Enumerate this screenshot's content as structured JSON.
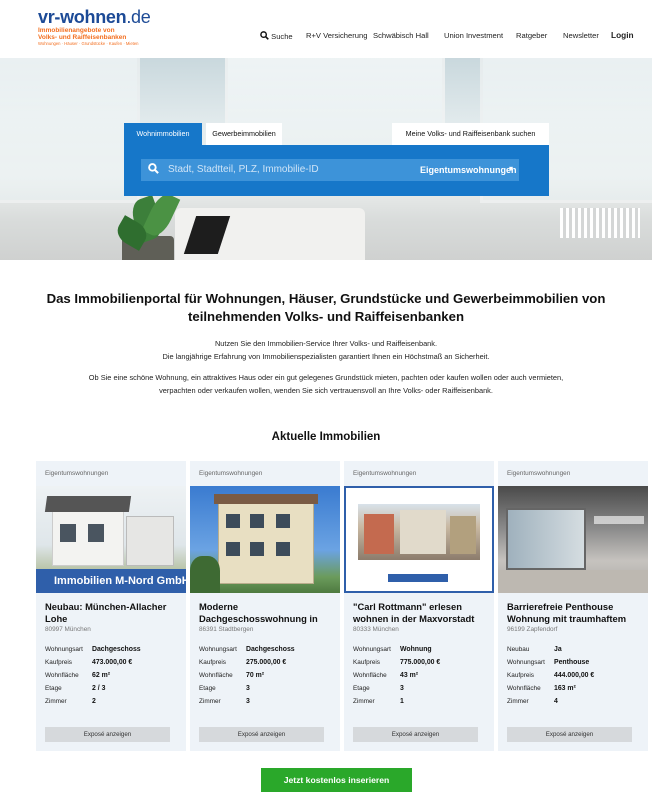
{
  "logo": {
    "main": "vr-wohnen",
    "tld": ".de",
    "line1": "Immobilienangebote von",
    "line2": "Volks- und Raiffeisenbanken",
    "tagline": "Wohnungen · Häuser · Grundstücke · Kaufen · Mieten"
  },
  "nav": {
    "search": "Suche",
    "items": [
      "R+V Versicherung",
      "Schwäbisch Hall",
      "Union Investment",
      "Ratgeber",
      "Newsletter"
    ],
    "login": "Login"
  },
  "search": {
    "tabs": [
      "Wohnimmobilien",
      "Gewerbeimmobilien"
    ],
    "bank_tab": "Meine Volks- und Raiffeisenbank suchen",
    "placeholder": "Stadt, Stadtteil, PLZ, Immobilie-ID",
    "type": "Eigentumswohnungen"
  },
  "intro": {
    "headline": "Das Immobilienportal für Wohnungen, Häuser, Grundstücke und Gewerbeimmobilien von teilnehmenden Volks- und Raiffeisenbanken",
    "p1_line1": "Nutzen Sie den Immobilien-Service Ihrer Volks- und Raiffeisenbank.",
    "p1_line2": "Die langjährige Erfahrung von Immobilienspezialisten garantiert Ihnen ein Höchstmaß an Sicherheit.",
    "p2_line1": "Ob Sie eine schöne Wohnung, ein attraktives Haus oder ein gut gelegenes Grundstück mieten, pachten oder kaufen wollen oder auch vermieten,",
    "p2_line2": "verpachten oder verkaufen wollen, wenden Sie sich vertrauensvoll an Ihre Volks- oder Raiffeisenbank."
  },
  "listings": {
    "title": "Aktuelle Immobilien",
    "expose_label": "Exposé anzeigen",
    "cards": [
      {
        "category": "Eigentumswohnungen",
        "image_caption": "Immobilien M-Nord GmbH",
        "title": "Neubau: München-Allacher Lohe",
        "location": "80997 München",
        "rows": [
          [
            "Wohnungsart",
            "Dachgeschoss"
          ],
          [
            "Kaufpreis",
            "473.000,00 €"
          ],
          [
            "Wohnfläche",
            "62 m²"
          ],
          [
            "Etage",
            "2 / 3"
          ],
          [
            "Zimmer",
            "2"
          ]
        ]
      },
      {
        "category": "Eigentumswohnungen",
        "image_caption": "",
        "title": "Moderne Dachgeschosswohnung in",
        "location": "86391 Stadtbergen",
        "rows": [
          [
            "Wohnungsart",
            "Dachgeschoss"
          ],
          [
            "Kaufpreis",
            "275.000,00 €"
          ],
          [
            "Wohnfläche",
            "70 m²"
          ],
          [
            "Etage",
            "3"
          ],
          [
            "Zimmer",
            "3"
          ]
        ]
      },
      {
        "category": "Eigentumswohnungen",
        "image_caption": "",
        "title": "\"Carl Rottmann\" erlesen wohnen in der Maxvorstadt",
        "location": "80333 München",
        "rows": [
          [
            "Wohnungsart",
            "Wohnung"
          ],
          [
            "Kaufpreis",
            "775.000,00 €"
          ],
          [
            "Wohnfläche",
            "43 m²"
          ],
          [
            "Etage",
            "3"
          ],
          [
            "Zimmer",
            "1"
          ]
        ]
      },
      {
        "category": "Eigentumswohnungen",
        "image_caption": "",
        "title": "Barrierefreie Penthouse Wohnung mit traumhaftem",
        "location": "96199 Zapfendorf",
        "rows": [
          [
            "Neubau",
            "Ja"
          ],
          [
            "Wohnungsart",
            "Penthouse"
          ],
          [
            "Kaufpreis",
            "444.000,00 €"
          ],
          [
            "Wohnfläche",
            "163 m²"
          ],
          [
            "Zimmer",
            "4"
          ]
        ]
      }
    ]
  },
  "cta": "Jetzt kostenlos inserieren",
  "colors": {
    "brand_blue": "#1c4a96",
    "search_blue": "#1677c9",
    "orange": "#f36f20",
    "cta_green": "#2aa82a",
    "card_bg": "#eef3f8"
  }
}
